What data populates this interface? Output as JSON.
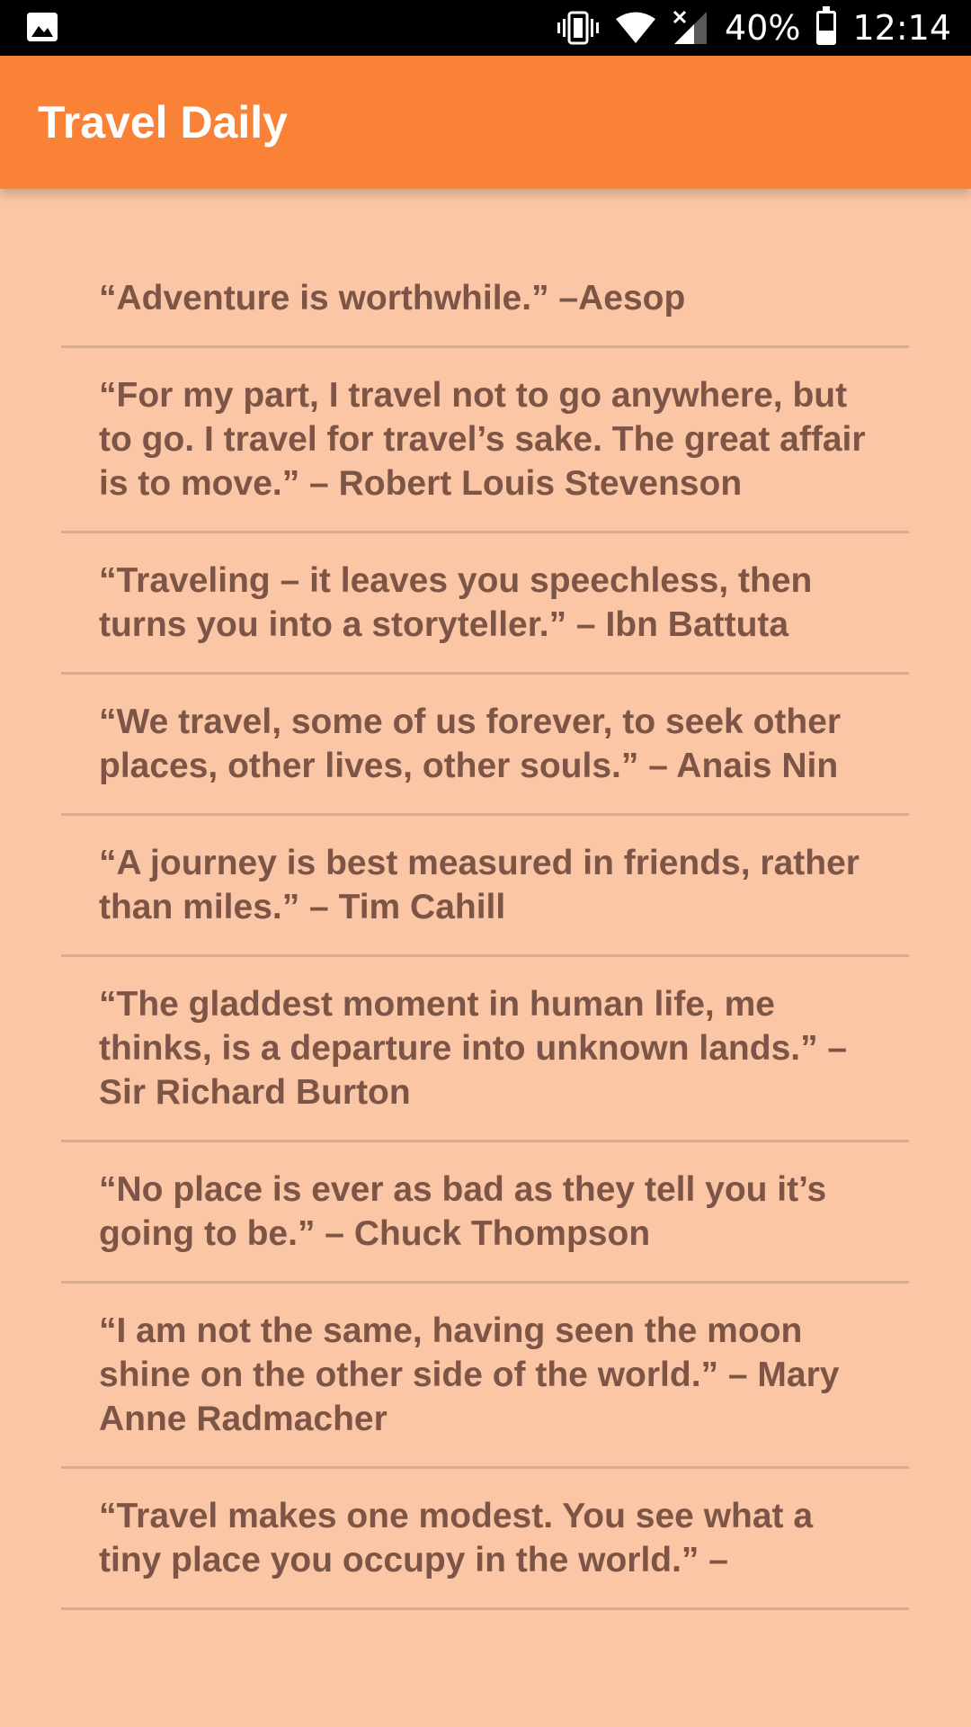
{
  "status_bar": {
    "battery_percent": "40%",
    "time": "12:14",
    "battery_level": 0.4
  },
  "app_bar": {
    "title": "Travel Daily",
    "color": "#f98236"
  },
  "quotes": [
    "“Adventure is worthwhile.” –Aesop",
    "“For my part, I travel not to go anywhere, but to go. I travel for travel’s sake. The great affair is to move.”      – Robert Louis Stevenson",
    "“Traveling – it leaves you speechless, then turns you into a storyteller.” – Ibn Battuta",
    "“We travel, some of us forever, to seek other places, other lives, other souls.” – Anais Nin",
    "“A journey is best measured in friends, rather than miles.” – Tim Cahill",
    "“The gladdest moment in human life, me thinks, is a departure into unknown lands.” – Sir Richard Burton",
    "“No place is ever as bad as they tell you it’s going to be.” – Chuck Thompson",
    "“I am not the same, having seen the moon shine on the other side of the world.” – Mary Anne Radmacher",
    "“Travel makes one modest. You see what a tiny place you occupy in the world.” –"
  ],
  "colors": {
    "background": "#fac6a5",
    "text": "#7d5546",
    "divider": "#d8ab8f"
  }
}
